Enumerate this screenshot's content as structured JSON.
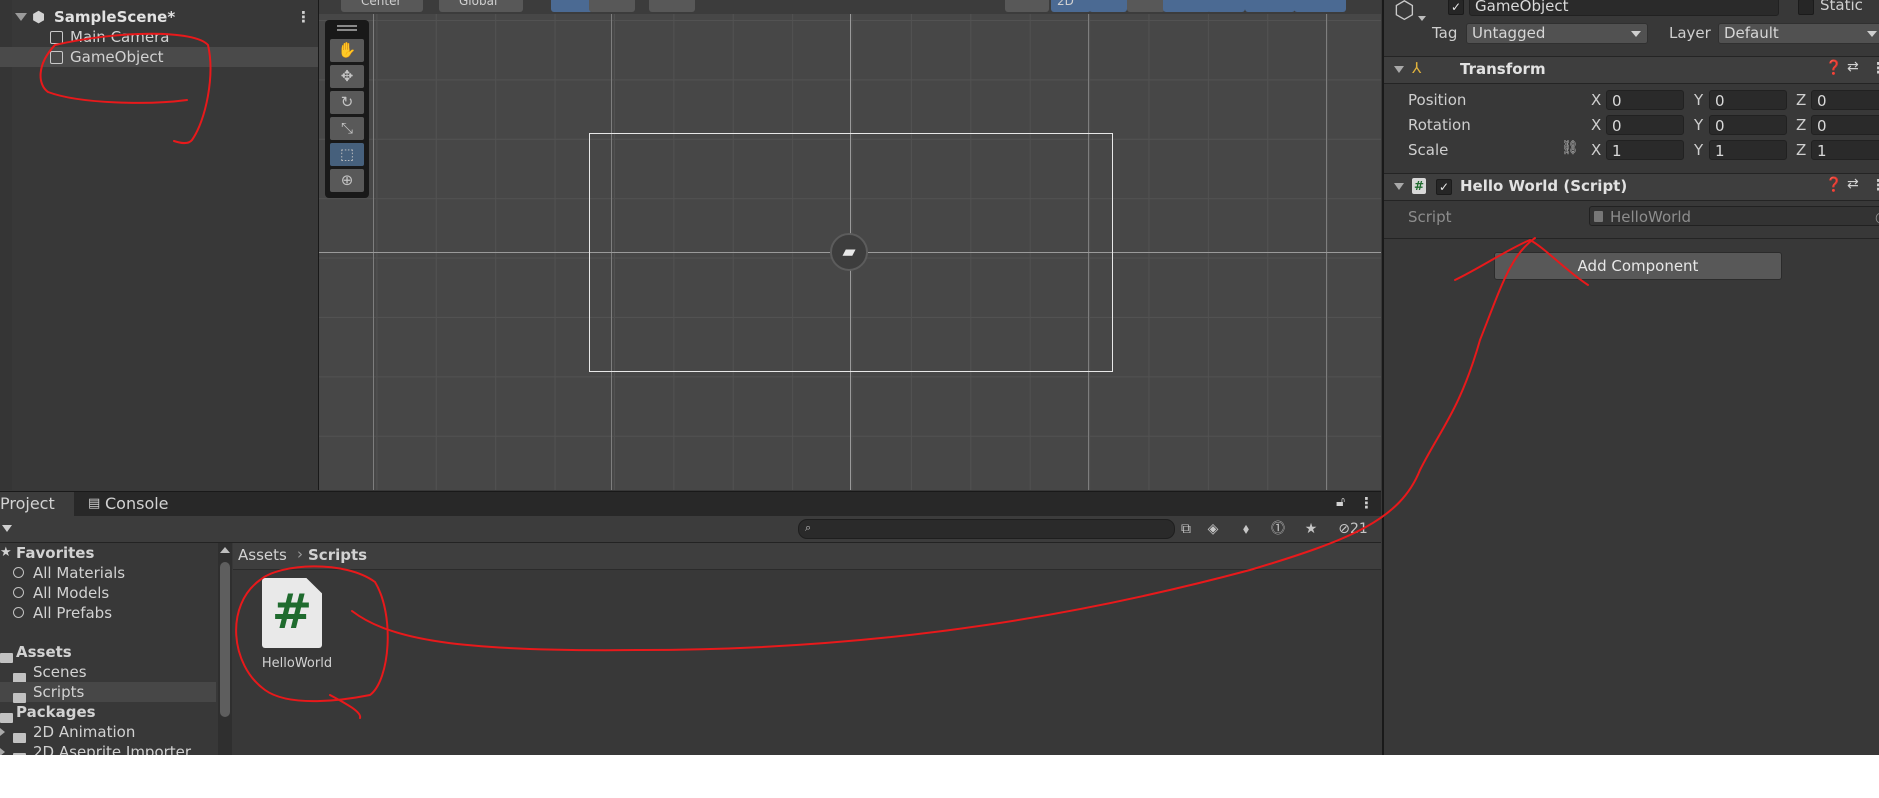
{
  "hierarchy": {
    "scene_name": "SampleScene*",
    "items": [
      {
        "label": "Main Camera"
      },
      {
        "label": "GameObject"
      }
    ]
  },
  "scene_toolbar": {
    "pivot_label": "Center",
    "space_label": "Global",
    "view_2d_label": "2D"
  },
  "inspector": {
    "object_name": "GameObject",
    "static_label": "Static",
    "tag_label": "Tag",
    "tag_value": "Untagged",
    "layer_label": "Layer",
    "layer_value": "Default",
    "transform": {
      "title": "Transform",
      "rows": [
        {
          "label": "Position",
          "x": "0",
          "y": "0",
          "z": "0"
        },
        {
          "label": "Rotation",
          "x": "0",
          "y": "0",
          "z": "0"
        },
        {
          "label": "Scale",
          "x": "1",
          "y": "1",
          "z": "1"
        }
      ],
      "axis_x": "X",
      "axis_y": "Y",
      "axis_z": "Z"
    },
    "script_component": {
      "title": "Hello World (Script)",
      "script_label": "Script",
      "script_value": "HelloWorld"
    },
    "add_component_label": "Add Component"
  },
  "project": {
    "tabs": [
      {
        "label": "Project"
      },
      {
        "label": "Console"
      }
    ],
    "hidden_count": "21",
    "favorites": {
      "label": "Favorites",
      "items": [
        {
          "label": "All Materials"
        },
        {
          "label": "All Models"
        },
        {
          "label": "All Prefabs"
        }
      ]
    },
    "assets": {
      "label": "Assets",
      "items": [
        {
          "label": "Scenes"
        },
        {
          "label": "Scripts"
        }
      ]
    },
    "packages": {
      "label": "Packages",
      "items": [
        {
          "label": "2D Animation"
        },
        {
          "label": "2D Aseprite Importer"
        }
      ]
    },
    "breadcrumb": {
      "root": "Assets",
      "current": "Scripts"
    },
    "files": [
      {
        "name": "HelloWorld",
        "icon": "csharp-script-icon",
        "glyph": "#"
      }
    ]
  },
  "colors": {
    "annotation": "#e8191b",
    "selection_blue": "#4b6a93",
    "script_green": "#1f6b2e"
  }
}
